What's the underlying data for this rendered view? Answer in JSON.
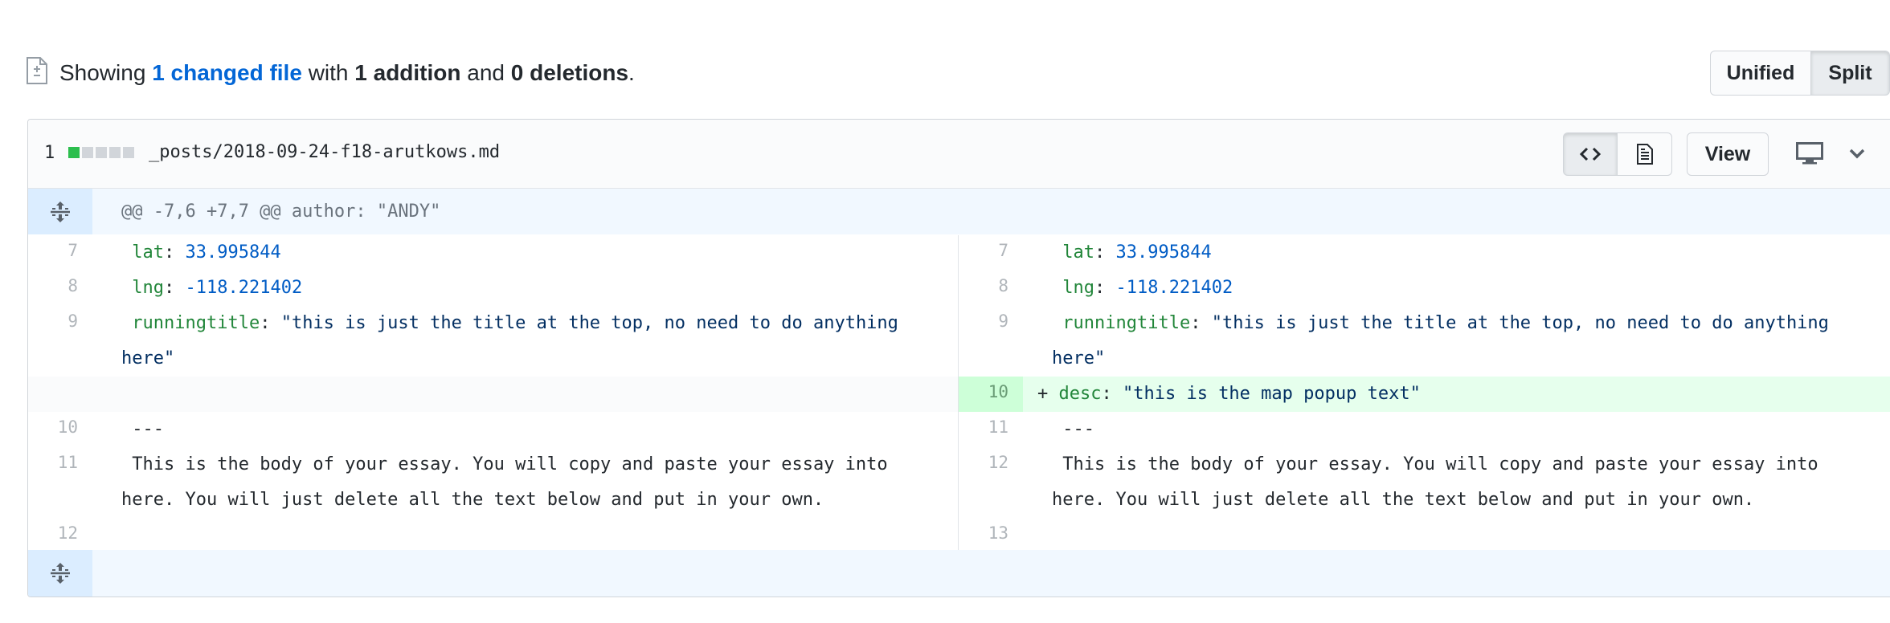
{
  "summary": {
    "showing": "Showing",
    "changed_files": "1 changed file",
    "with": "with",
    "additions": "1 addition",
    "and": "and",
    "deletions": "0 deletions",
    "period": "."
  },
  "view_toggle": {
    "unified": "Unified",
    "split": "Split",
    "selected": "Split"
  },
  "file": {
    "change_count": "1",
    "diffstat": {
      "additions": 1,
      "neutral": 4
    },
    "path": "_posts/2018-09-24-f18-arutkows.md",
    "view_button": "View"
  },
  "hunk_header": "@@ -7,6 +7,7 @@ author: \"ANDY\"",
  "left_lines": [
    {
      "num": "7",
      "key": "lat",
      "sep": ": ",
      "val": "33.995844"
    },
    {
      "num": "8",
      "key": "lng",
      "sep": ": ",
      "val": "-118.221402"
    },
    {
      "num": "9",
      "key": "runningtitle",
      "sep": ": ",
      "val": "\"this is just the title at the top, no need to do anything here\""
    },
    {
      "num": "",
      "text": ""
    },
    {
      "num": "10",
      "text": "---"
    },
    {
      "num": "11",
      "text": "This is the body of your essay. You will copy and paste your essay into here. You will just delete all the text below and put in your own."
    },
    {
      "num": "12",
      "text": ""
    }
  ],
  "right_lines": [
    {
      "num": "7",
      "key": "lat",
      "sep": ": ",
      "val": "33.995844"
    },
    {
      "num": "8",
      "key": "lng",
      "sep": ": ",
      "val": "-118.221402"
    },
    {
      "num": "9",
      "key": "runningtitle",
      "sep": ": ",
      "val": "\"this is just the title at the top, no need to do anything here\""
    },
    {
      "num": "10",
      "marker": "+",
      "key": "desc",
      "sep": ": ",
      "val": "\"this is the map popup text\""
    },
    {
      "num": "11",
      "text": "---"
    },
    {
      "num": "12",
      "text": "This is the body of your essay. You will copy and paste your essay into here. You will just delete all the text below and put in your own."
    },
    {
      "num": "13",
      "text": ""
    }
  ]
}
